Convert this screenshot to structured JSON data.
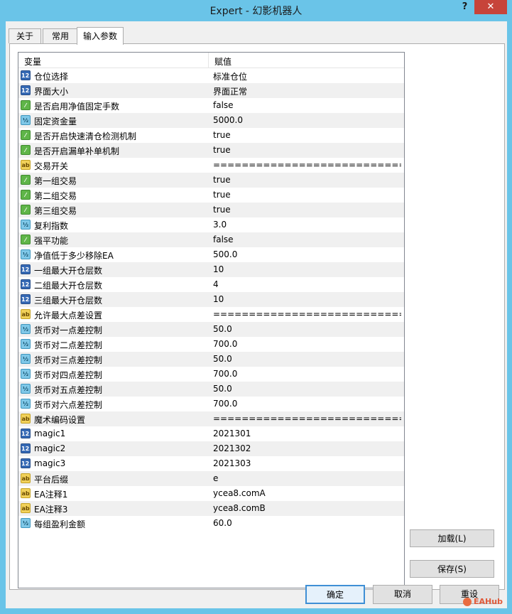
{
  "window": {
    "title": "Expert - 幻影机器人",
    "help_label": "?",
    "close_label": "✕"
  },
  "tabs": [
    {
      "label": "关于",
      "active": false
    },
    {
      "label": "常用",
      "active": false
    },
    {
      "label": "输入参数",
      "active": true
    }
  ],
  "grid": {
    "headers": {
      "variable": "变量",
      "value": "赋值"
    },
    "rows": [
      {
        "icon": "int",
        "name": "仓位选择",
        "value": "标准仓位"
      },
      {
        "icon": "int",
        "name": "界面大小",
        "value": "界面正常"
      },
      {
        "icon": "bool",
        "name": "是否启用净值固定手数",
        "value": "false"
      },
      {
        "icon": "double",
        "name": "固定资金量",
        "value": "5000.0"
      },
      {
        "icon": "bool",
        "name": "是否开启快速清仓检测机制",
        "value": "true"
      },
      {
        "icon": "bool",
        "name": "是否开启漏单补单机制",
        "value": "true"
      },
      {
        "icon": "string",
        "name": "交易开关",
        "value": "================================..."
      },
      {
        "icon": "bool",
        "name": "第一组交易",
        "value": "true"
      },
      {
        "icon": "bool",
        "name": "第二组交易",
        "value": "true"
      },
      {
        "icon": "bool",
        "name": "第三组交易",
        "value": "true"
      },
      {
        "icon": "double",
        "name": "复利指数",
        "value": "3.0"
      },
      {
        "icon": "bool",
        "name": "强平功能",
        "value": "false"
      },
      {
        "icon": "double",
        "name": "净值低于多少移除EA",
        "value": "500.0"
      },
      {
        "icon": "int",
        "name": "一组最大开仓层数",
        "value": "10"
      },
      {
        "icon": "int",
        "name": "二组最大开仓层数",
        "value": "4"
      },
      {
        "icon": "int",
        "name": "三组最大开仓层数",
        "value": "10"
      },
      {
        "icon": "string",
        "name": "允许最大点差设置",
        "value": "================================..."
      },
      {
        "icon": "double",
        "name": "货币对一点差控制",
        "value": "50.0"
      },
      {
        "icon": "double",
        "name": "货币对二点差控制",
        "value": "700.0"
      },
      {
        "icon": "double",
        "name": "货币对三点差控制",
        "value": "50.0"
      },
      {
        "icon": "double",
        "name": "货币对四点差控制",
        "value": "700.0"
      },
      {
        "icon": "double",
        "name": "货币对五点差控制",
        "value": "50.0"
      },
      {
        "icon": "double",
        "name": "货币对六点差控制",
        "value": "700.0"
      },
      {
        "icon": "string",
        "name": "魔术编码设置",
        "value": "================================..."
      },
      {
        "icon": "int",
        "name": "magic1",
        "value": "2021301"
      },
      {
        "icon": "int",
        "name": "magic2",
        "value": "2021302"
      },
      {
        "icon": "int",
        "name": "magic3",
        "value": "2021303"
      },
      {
        "icon": "string",
        "name": "平台后缀",
        "value": "e"
      },
      {
        "icon": "string",
        "name": "EA注释1",
        "value": "ycea8.comA"
      },
      {
        "icon": "string",
        "name": "EA注释3",
        "value": "ycea8.comB"
      },
      {
        "icon": "double",
        "name": "每组盈利金额",
        "value": "60.0"
      }
    ]
  },
  "icon_glyphs": {
    "int": "123",
    "bool": "⁄",
    "double": "½",
    "string": "ab"
  },
  "side_buttons": {
    "load": "加载(L)",
    "save": "保存(S)"
  },
  "bottom_buttons": {
    "ok": "确定",
    "cancel": "取消",
    "reset": "重设"
  },
  "watermark": {
    "text": "EAHub"
  },
  "colors": {
    "titlebar": "#6ac4e8",
    "close": "#c7443a",
    "default_button_border": "#3f8fd5"
  }
}
